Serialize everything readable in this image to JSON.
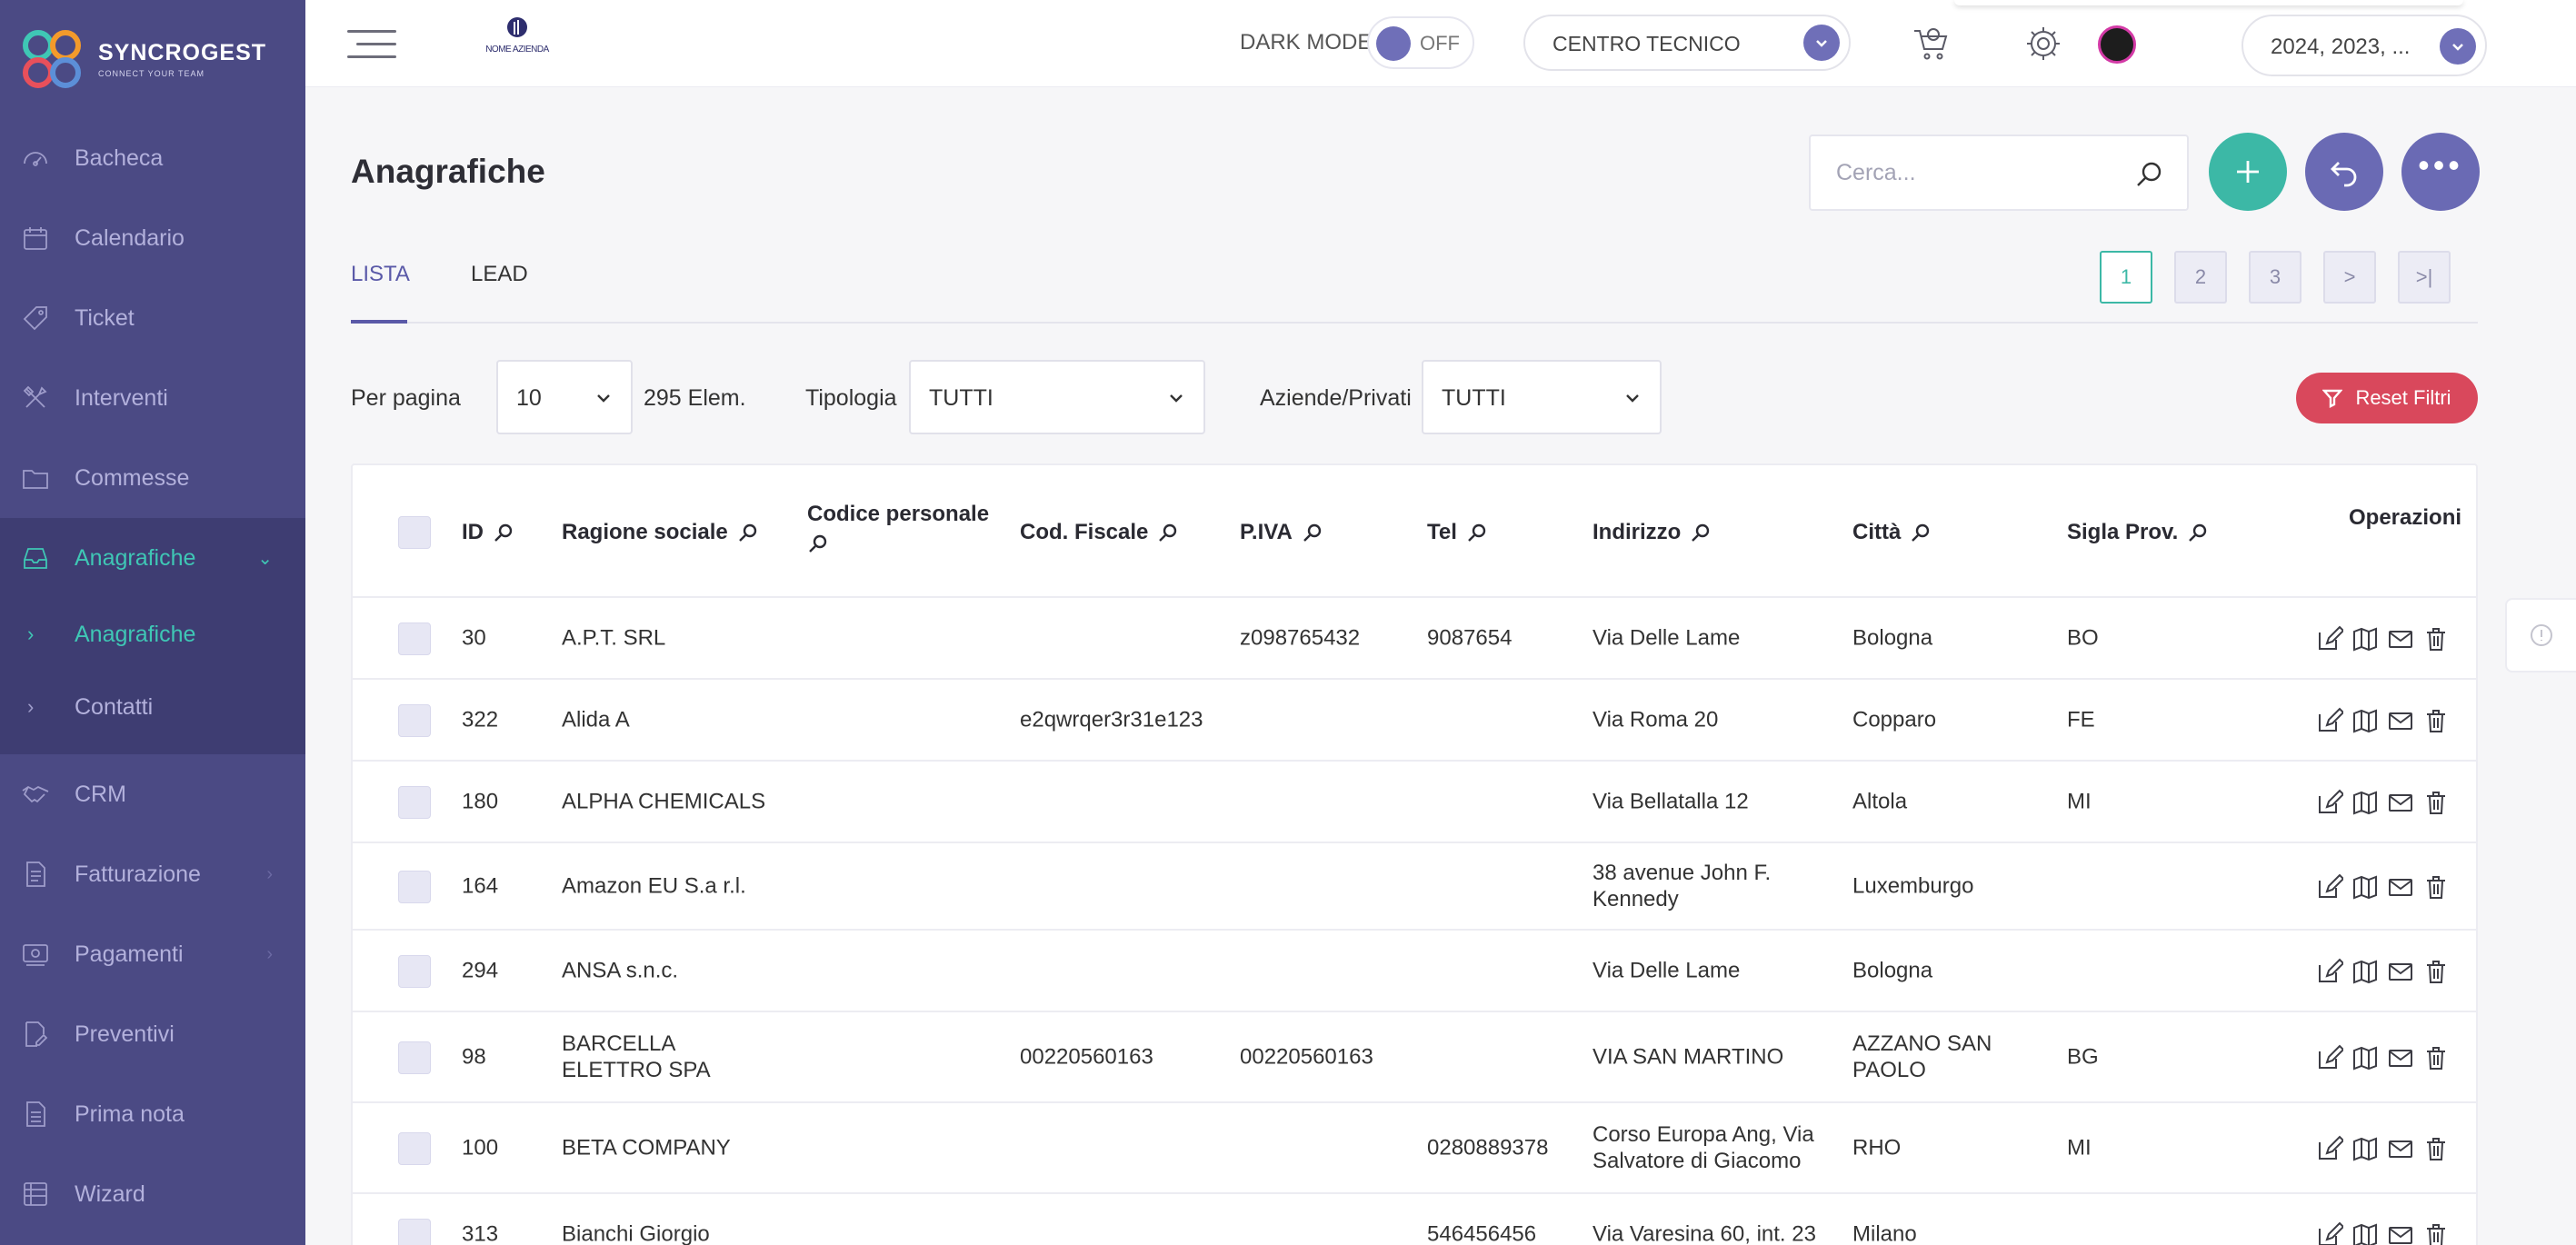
{
  "brand": {
    "name": "SYNCROGEST",
    "tagline": "CONNECT YOUR TEAM"
  },
  "sidebar": {
    "items": [
      {
        "label": "Bacheca",
        "icon": "dashboard-icon"
      },
      {
        "label": "Calendario",
        "icon": "calendar-icon"
      },
      {
        "label": "Ticket",
        "icon": "ticket-icon"
      },
      {
        "label": "Interventi",
        "icon": "tools-icon"
      },
      {
        "label": "Commesse",
        "icon": "folder-icon"
      },
      {
        "label": "Anagrafiche",
        "icon": "inbox-icon",
        "active": true,
        "expanded": true
      },
      {
        "label": "CRM",
        "icon": "handshake-icon"
      },
      {
        "label": "Fatturazione",
        "icon": "document-icon"
      },
      {
        "label": "Pagamenti",
        "icon": "payments-icon"
      },
      {
        "label": "Preventivi",
        "icon": "quote-icon"
      },
      {
        "label": "Prima nota",
        "icon": "note-icon"
      },
      {
        "label": "Wizard",
        "icon": "list-icon"
      }
    ],
    "subitems": [
      {
        "label": "Anagrafiche",
        "active": true
      },
      {
        "label": "Contatti"
      }
    ]
  },
  "topbar": {
    "company_logo_text": "NOME AZIENDA",
    "dark_mode_label": "DARK MODE",
    "dark_mode_state": "OFF",
    "center_select": "CENTRO TECNICO",
    "years": "2024, 2023, ..."
  },
  "page": {
    "title": "Anagrafiche",
    "search_placeholder": "Cerca...",
    "tabs": [
      "LISTA",
      "LEAD"
    ],
    "active_tab": "LISTA",
    "pages": [
      "1",
      "2",
      "3",
      ">",
      ">|"
    ],
    "current_page": "1"
  },
  "filters": {
    "per_page_label": "Per pagina",
    "per_page_value": "10",
    "count": "295 Elem.",
    "tipologia_label": "Tipologia",
    "tipologia_value": "TUTTI",
    "aziende_label": "Aziende/Privati",
    "aziende_value": "TUTTI",
    "reset_label": "Reset Filtri"
  },
  "table": {
    "columns": [
      "ID",
      "Ragione sociale",
      "Codice personale",
      "Cod. Fiscale",
      "P.IVA",
      "Tel",
      "Indirizzo",
      "Città",
      "Sigla Prov.",
      "Operazioni"
    ],
    "rows": [
      {
        "id": "30",
        "ragione": "A.P.T. SRL",
        "codpers": "",
        "codfisc": "",
        "piva": "z098765432",
        "tel": "9087654",
        "indirizzo": "Via Delle Lame",
        "citta": "Bologna",
        "prov": "BO"
      },
      {
        "id": "322",
        "ragione": "Alida A",
        "codpers": "",
        "codfisc": "e2qwrqer3r31e123",
        "piva": "",
        "tel": "",
        "indirizzo": "Via Roma 20",
        "citta": "Copparo",
        "prov": "FE"
      },
      {
        "id": "180",
        "ragione": "ALPHA CHEMICALS",
        "codpers": "",
        "codfisc": "",
        "piva": "",
        "tel": "",
        "indirizzo": "Via Bellatalla 12",
        "citta": "Altola",
        "prov": "MI"
      },
      {
        "id": "164",
        "ragione": "Amazon EU S.a r.l.",
        "codpers": "",
        "codfisc": "",
        "piva": "",
        "tel": "",
        "indirizzo": "38 avenue John F. Kennedy",
        "citta": "Luxemburgo",
        "prov": ""
      },
      {
        "id": "294",
        "ragione": "ANSA s.n.c.",
        "codpers": "",
        "codfisc": "",
        "piva": "",
        "tel": "",
        "indirizzo": "Via Delle Lame",
        "citta": "Bologna",
        "prov": ""
      },
      {
        "id": "98",
        "ragione": "BARCELLA ELETTRO SPA",
        "codpers": "",
        "codfisc": "00220560163",
        "piva": "00220560163",
        "tel": "",
        "indirizzo": "VIA SAN MARTINO",
        "citta": "AZZANO SAN PAOLO",
        "prov": "BG"
      },
      {
        "id": "100",
        "ragione": "BETA COMPANY",
        "codpers": "",
        "codfisc": "",
        "piva": "",
        "tel": "0280889378",
        "indirizzo": "Corso Europa Ang, Via Salvatore di Giacomo",
        "citta": "RHO",
        "prov": "MI"
      },
      {
        "id": "313",
        "ragione": "Bianchi Giorgio",
        "codpers": "",
        "codfisc": "",
        "piva": "",
        "tel": "546456456",
        "indirizzo": "Via Varesina 60, int. 23",
        "citta": "Milano",
        "prov": ""
      }
    ]
  },
  "colors": {
    "sidebar": "#4b4a84",
    "accent_teal": "#3cb8a6",
    "accent_purple": "#6a6ab4",
    "danger": "#d9485c"
  }
}
